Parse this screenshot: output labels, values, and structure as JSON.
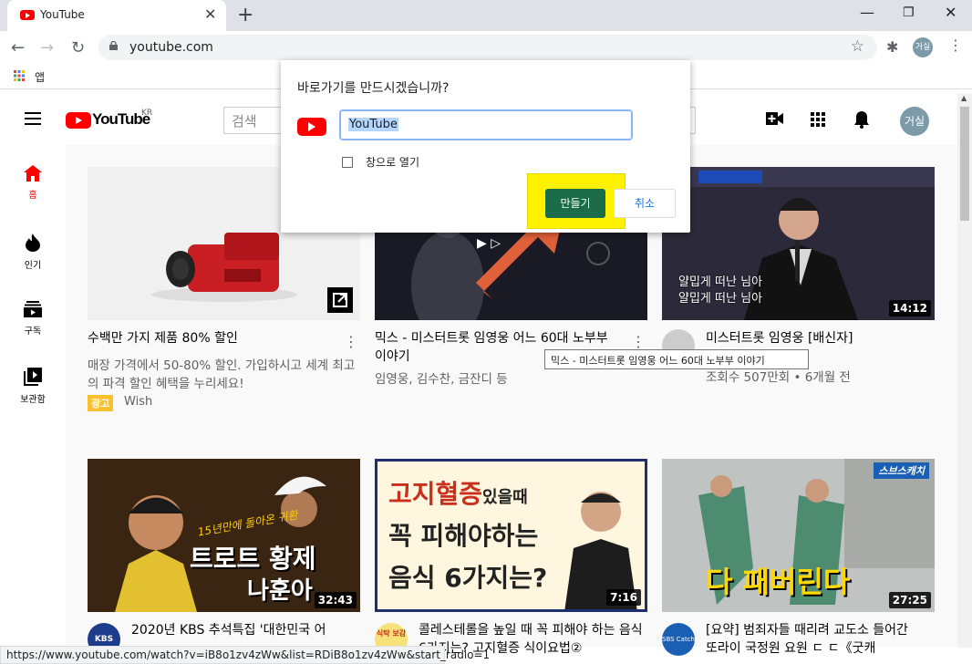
{
  "browser": {
    "tab_title": "YouTube",
    "url": "youtube.com",
    "bookmark_apps_label": "앱",
    "profile_initials": "거실"
  },
  "header": {
    "logo_text": "YouTube",
    "logo_region": "KR",
    "search_placeholder": "검색",
    "avatar_initials": "거실"
  },
  "sidebar": {
    "items": [
      {
        "label": "홈",
        "icon": "home-icon"
      },
      {
        "label": "인기",
        "icon": "flame-icon"
      },
      {
        "label": "구독",
        "icon": "subscriptions-icon"
      },
      {
        "label": "보관함",
        "icon": "library-icon"
      }
    ]
  },
  "videos": [
    {
      "title": "수백만 가지 제품 80% 할인",
      "desc": "매장 가격에서 50-80% 할인. 가입하시고 세계 최고의 파격 할인 혜택을 누리세요!",
      "ad_badge": "광고",
      "advertiser": "Wish"
    },
    {
      "title": "믹스 - 미스터트롯 임영웅 어느 60대 노부부 이야기",
      "channel": "임영웅, 김수찬, 금잔디 등"
    },
    {
      "title": "미스터트롯 임영웅 [배신자]",
      "channel": "",
      "stats": "조회수 507만회 • 6개월 전",
      "duration": "14:12",
      "overlay_text": "얄밉게 떠난 님아"
    },
    {
      "title": "2020년 KBS 추석특집 '대한민국 어",
      "duration": "32:43",
      "channel_badge": "KBS",
      "thumb_caption_1": "15년만에 돌아온 귀환",
      "thumb_caption_2": "트로트 황제",
      "thumb_caption_3": "나훈아"
    },
    {
      "title": "콜레스테롤을 높일 때 꼭 피해야 하는 음식 6가지는? 고지혈증 식이요법②",
      "duration": "7:16",
      "channel_badge": "식탁 보감",
      "thumb_line_1": "고지혈증",
      "thumb_line_1b": "있을때",
      "thumb_line_2": "꼭 피해야하는",
      "thumb_line_3": "음식 6가지는?"
    },
    {
      "title": "[요약] 범죄자들 때리려 교도소 들어간 또라이 국정원 요원 ㄷ ㄷ《굿캐",
      "duration": "27:25",
      "channel_badge": "SBS Catch",
      "thumb_corner": "스브스캐치",
      "thumb_caption": "다 패버린다"
    }
  ],
  "tooltip": "믹스 - 미스터트롯 임영웅 어느 60대 노부부 이야기",
  "status_url": "https://www.youtube.com/watch?v=iB8o1zv4zWw&list=RDiB8o1zv4zWw&start_radio=1",
  "dialog": {
    "title": "바로가기를 만드시겠습니까?",
    "name_value": "YouTube",
    "open_window_label": "창으로 열기",
    "create_label": "만들기",
    "cancel_label": "취소"
  },
  "colors": {
    "youtube_red": "#ff0000",
    "create_button": "#1b6d49",
    "highlight": "#fff200",
    "arrow": "#e0603a"
  }
}
